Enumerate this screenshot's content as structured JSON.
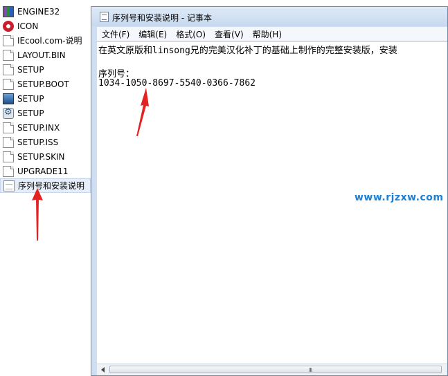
{
  "explorer": {
    "files": [
      {
        "name": "ENGINE32",
        "icon": "winrar-archive-icon",
        "selected": false
      },
      {
        "name": "ICON",
        "icon": "icon-file-icon",
        "selected": false
      },
      {
        "name": "IEcool.com-说明",
        "icon": "document-icon",
        "selected": false
      },
      {
        "name": "LAYOUT.BIN",
        "icon": "document-icon",
        "selected": false
      },
      {
        "name": "SETUP",
        "icon": "document-icon",
        "selected": false
      },
      {
        "name": "SETUP.BOOT",
        "icon": "document-icon",
        "selected": false
      },
      {
        "name": "SETUP",
        "icon": "installer-icon",
        "selected": false
      },
      {
        "name": "SETUP",
        "icon": "settings-file-icon",
        "selected": false
      },
      {
        "name": "SETUP.INX",
        "icon": "document-icon",
        "selected": false
      },
      {
        "name": "SETUP.ISS",
        "icon": "document-icon",
        "selected": false
      },
      {
        "name": "SETUP.SKIN",
        "icon": "document-icon",
        "selected": false
      },
      {
        "name": "UPGRADE11",
        "icon": "document-icon",
        "selected": false
      },
      {
        "name": "序列号和安装说明",
        "icon": "text-file-icon",
        "selected": true
      }
    ]
  },
  "notepad": {
    "title": "序列号和安装说明 - 记事本",
    "menu": [
      "文件(F)",
      "编辑(E)",
      "格式(O)",
      "查看(V)",
      "帮助(H)"
    ],
    "content": {
      "line1": "在英文原版和linsong兄的完美汉化补丁的基础上制作的完整安装版，安装",
      "line2": "",
      "line3": "序列号：",
      "line4": "1034-1050-8697-5540-0366-7862"
    },
    "scrollbar_grip": "III"
  },
  "watermark": "www.rjzxw.com",
  "colors": {
    "annotation_arrow": "#e52222",
    "watermark": "#1a7fd6",
    "selection": "#e5eef9"
  }
}
